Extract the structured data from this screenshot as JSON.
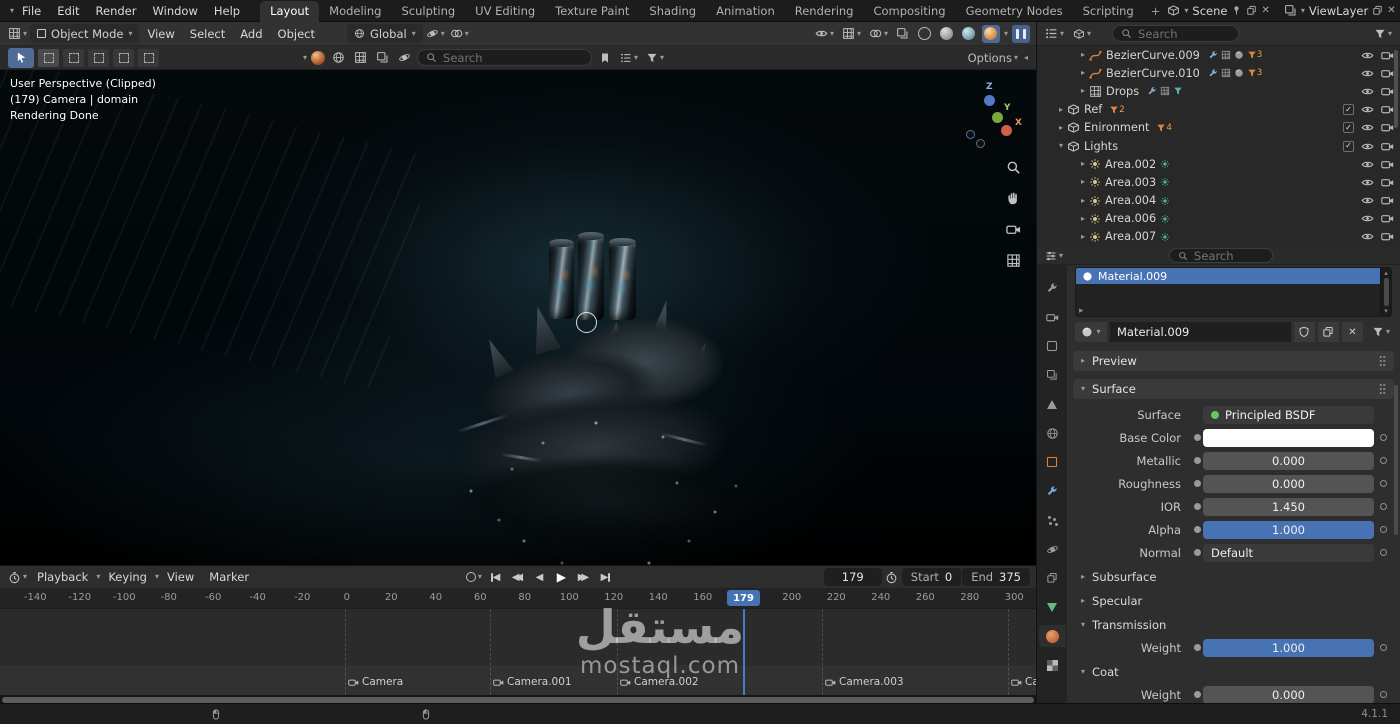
{
  "icons": {
    "caret_down": "▾",
    "caret_right": "▸",
    "caret_left": "◂",
    "close": "✕",
    "check": "✓",
    "play": "▶",
    "rewind": "◀",
    "up": "▴",
    "down": "▾"
  },
  "topbar": {
    "menus": [
      "File",
      "Edit",
      "Render",
      "Window",
      "Help"
    ],
    "tabs": [
      "Layout",
      "Modeling",
      "Sculpting",
      "UV Editing",
      "Texture Paint",
      "Shading",
      "Animation",
      "Rendering",
      "Compositing",
      "Geometry Nodes",
      "Scripting"
    ],
    "new_workspace": "+",
    "scene": {
      "label": "Scene"
    },
    "view_layer": {
      "label": "ViewLayer"
    }
  },
  "viewport": {
    "header": {
      "mode": "Object Mode",
      "menus": [
        "View",
        "Select",
        "Add",
        "Object"
      ],
      "orientation": "Global"
    },
    "tool_settings": {
      "search_placeholder": "Search",
      "options_label": "Options"
    },
    "overlay": {
      "line1": "User Perspective (Clipped)",
      "line2": "(179) Camera | domain",
      "line3": "Rendering Done"
    },
    "gizmo": {
      "x": "X",
      "y": "Y",
      "z": "Z"
    }
  },
  "timeline": {
    "menus": [
      "Playback",
      "Keying",
      "View",
      "Marker"
    ],
    "current_frame": "179",
    "frame_display": "179",
    "start": {
      "label": "Start",
      "value": "0"
    },
    "end": {
      "label": "End",
      "value": "375"
    },
    "ticks": [
      "-140",
      "-120",
      "-100",
      "-80",
      "-60",
      "-40",
      "-20",
      "0",
      "20",
      "40",
      "60",
      "80",
      "100",
      "120",
      "140",
      "160",
      "",
      "200",
      "220",
      "240",
      "260",
      "280",
      "300"
    ],
    "markers": [
      {
        "label": "Camera"
      },
      {
        "label": "Camera.001"
      },
      {
        "label": "Camera.002"
      },
      {
        "label": "Camera.003"
      },
      {
        "label": "Ca"
      }
    ]
  },
  "outliner": {
    "search_placeholder": "Search",
    "items": [
      {
        "label": "BezierCurve.009",
        "badge": "3"
      },
      {
        "label": "BezierCurve.010",
        "badge": "3"
      },
      {
        "label": "Drops",
        "badge": ""
      },
      {
        "label": "Ref",
        "badge": "2"
      },
      {
        "label": "Enironment",
        "badge": "4"
      },
      {
        "label": "Lights",
        "badge": ""
      },
      {
        "label": "Area.002"
      },
      {
        "label": "Area.003"
      },
      {
        "label": "Area.004"
      },
      {
        "label": "Area.006"
      },
      {
        "label": "Area.007"
      }
    ]
  },
  "properties": {
    "search_placeholder": "Search",
    "active_slot": "Material.009",
    "material_name": "Material.009",
    "panels": {
      "preview": "Preview",
      "surface": "Surface",
      "subsurface": "Subsurface",
      "specular": "Specular",
      "transmission": "Transmission",
      "coat": "Coat"
    },
    "fields": {
      "surface": {
        "label": "Surface",
        "value": "Principled BSDF"
      },
      "base_color": {
        "label": "Base Color",
        "swatch": "#ffffff"
      },
      "metallic": {
        "label": "Metallic",
        "value": "0.000"
      },
      "roughness": {
        "label": "Roughness",
        "value": "0.000"
      },
      "ior": {
        "label": "IOR",
        "value": "1.450"
      },
      "alpha": {
        "label": "Alpha",
        "value": "1.000"
      },
      "normal": {
        "label": "Normal",
        "value": "Default"
      },
      "transmission_weight": {
        "label": "Weight",
        "value": "1.000"
      },
      "coat_weight": {
        "label": "Weight",
        "value": "0.000"
      }
    }
  },
  "statusbar": {
    "version": "4.1.1"
  },
  "watermark": {
    "title": "مستقل",
    "site": "mostaql.com"
  }
}
